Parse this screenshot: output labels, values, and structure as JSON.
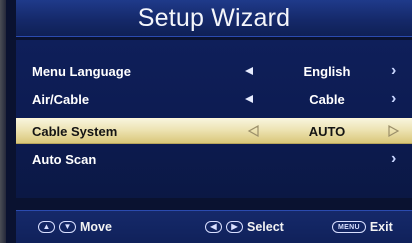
{
  "title": "Setup Wizard",
  "rows": [
    {
      "label": "Menu Language",
      "value": "English",
      "has_left": true,
      "has_right": true
    },
    {
      "label": "Air/Cable",
      "value": "Cable",
      "has_left": true,
      "has_right": true
    },
    {
      "label": "Cable System",
      "value": "AUTO",
      "has_left": true,
      "has_right": true,
      "selected": true
    },
    {
      "label": "Auto Scan",
      "value": "",
      "has_left": false,
      "has_right": true
    }
  ],
  "footer": {
    "move_label": "Move",
    "select_label": "Select",
    "menu_key": "MENU",
    "exit_label": "Exit"
  },
  "colors": {
    "title_bar": "#1f3a8a",
    "menu_bg": "#0f1f5a",
    "selected_row": "#ede3b3",
    "text": "#ffffff"
  }
}
